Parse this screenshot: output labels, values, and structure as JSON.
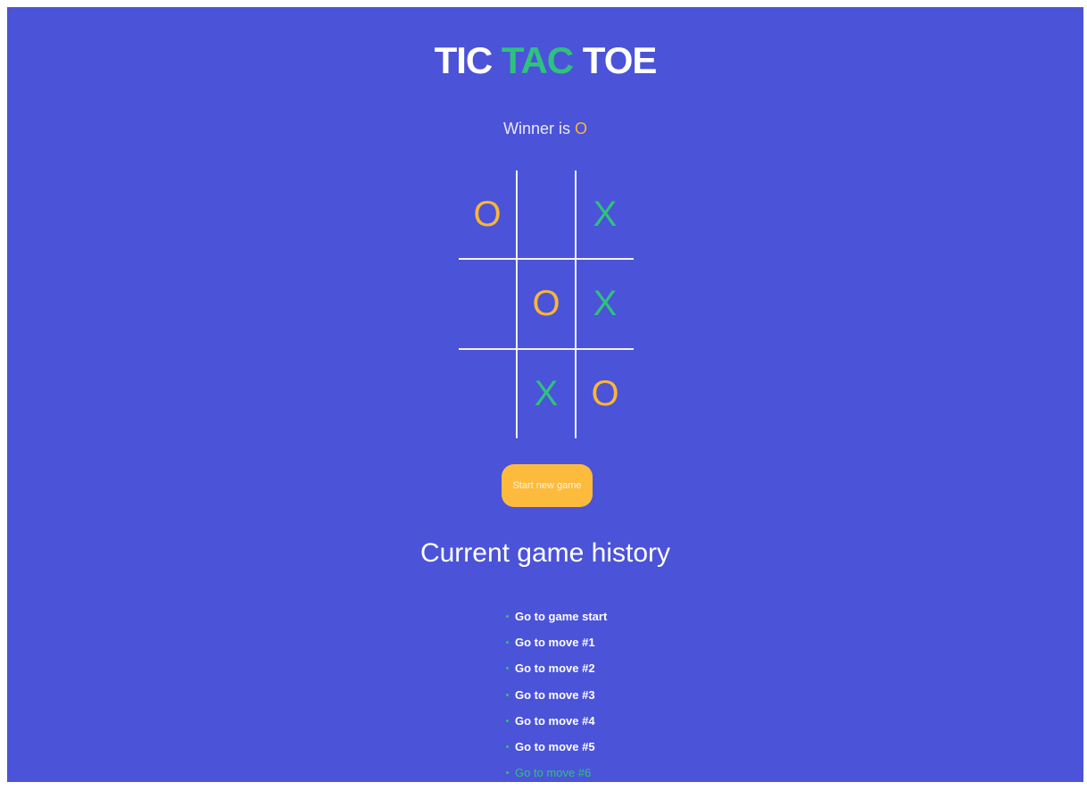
{
  "colors": {
    "background": "#4b53d8",
    "x_mark": "#2ec27e",
    "o_mark": "#f9b53a",
    "button": "#fdbb3d",
    "grid_line": "#f1f1fb"
  },
  "header": {
    "title_word1": "TIC",
    "title_word2": "TAC",
    "title_word3": "TOE"
  },
  "status": {
    "prefix": "Winner is",
    "winner": "O"
  },
  "board": {
    "cells": [
      "O",
      "",
      "X",
      "",
      "O",
      "X",
      "",
      "X",
      "O"
    ]
  },
  "controls": {
    "new_game_label": "Start new game"
  },
  "history": {
    "title": "Current game history",
    "items": [
      "Go to game start",
      "Go to move #1",
      "Go to move #2",
      "Go to move #3",
      "Go to move #4",
      "Go to move #5",
      "Go to move #6"
    ],
    "current_index": 6
  }
}
